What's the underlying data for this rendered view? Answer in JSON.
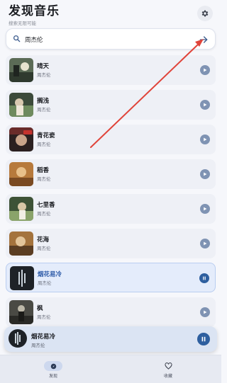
{
  "header": {
    "title": "发现音乐",
    "subtitle": "搜索无限可能"
  },
  "search": {
    "value": "周杰伦",
    "placeholder": ""
  },
  "songs": [
    {
      "title": "晴天",
      "artist": "周杰伦"
    },
    {
      "title": "搁浅",
      "artist": "周杰伦"
    },
    {
      "title": "青花瓷",
      "artist": "周杰伦"
    },
    {
      "title": "稻香",
      "artist": "周杰伦"
    },
    {
      "title": "七里香",
      "artist": "周杰伦"
    },
    {
      "title": "花海",
      "artist": "周杰伦"
    },
    {
      "title": "烟花易冷",
      "artist": "周杰伦"
    },
    {
      "title": "枫",
      "artist": "周杰伦"
    }
  ],
  "now_playing": {
    "title": "烟花易冷",
    "artist": "周杰伦"
  },
  "nav": {
    "discover_label": "发现",
    "favorites_label": "收藏"
  },
  "colors": {
    "accent": "#2e5f9f",
    "annotation_arrow": "#e0443a"
  }
}
